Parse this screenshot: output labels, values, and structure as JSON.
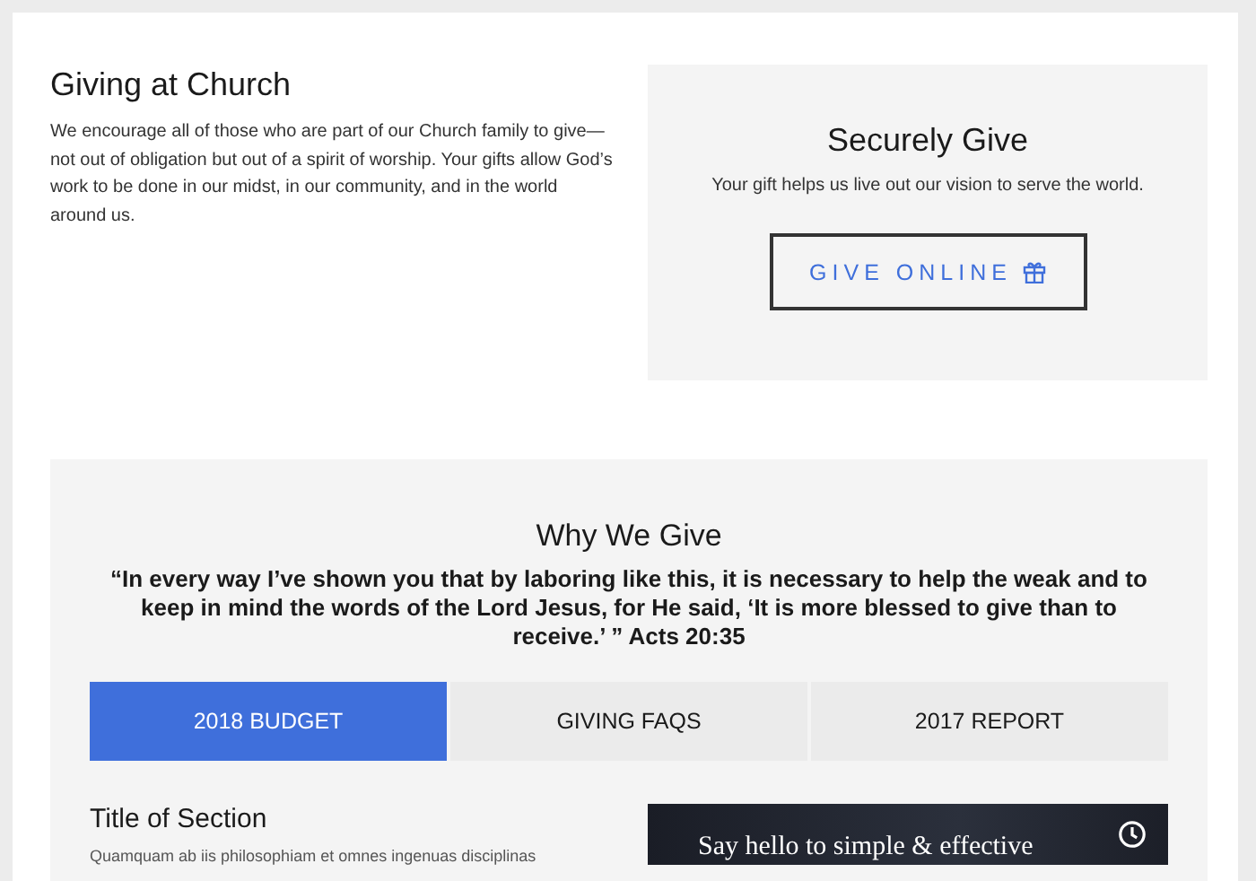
{
  "intro": {
    "title": "Giving at Church",
    "text": "We encourage all of those who are part of our Church family to give—not out of obligation but out of a spirit of worship. Your gifts allow God’s work to be done in our midst, in our community, and in the world around us."
  },
  "give_card": {
    "title": "Securely Give",
    "subtitle": "Your gift helps us live out our vision to serve the world.",
    "button": "GIVE ONLINE"
  },
  "why": {
    "title": "Why We Give",
    "quote": "“In every way I’ve shown you that by laboring like this, it is necessary to help the weak and to keep in mind the words of the Lord Jesus, for He said, ‘It is more blessed to give than to receive.’ ” Acts 20:35"
  },
  "tabs": [
    {
      "label": "2018 BUDGET",
      "selected": true
    },
    {
      "label": "GIVING FAQS",
      "selected": false
    },
    {
      "label": "2017 REPORT",
      "selected": false
    }
  ],
  "section": {
    "title": "Title of Section",
    "text": "Quamquam ab iis philosophiam et omnes ingenuas disciplinas"
  },
  "video": {
    "title": "Say hello to simple & effective"
  }
}
